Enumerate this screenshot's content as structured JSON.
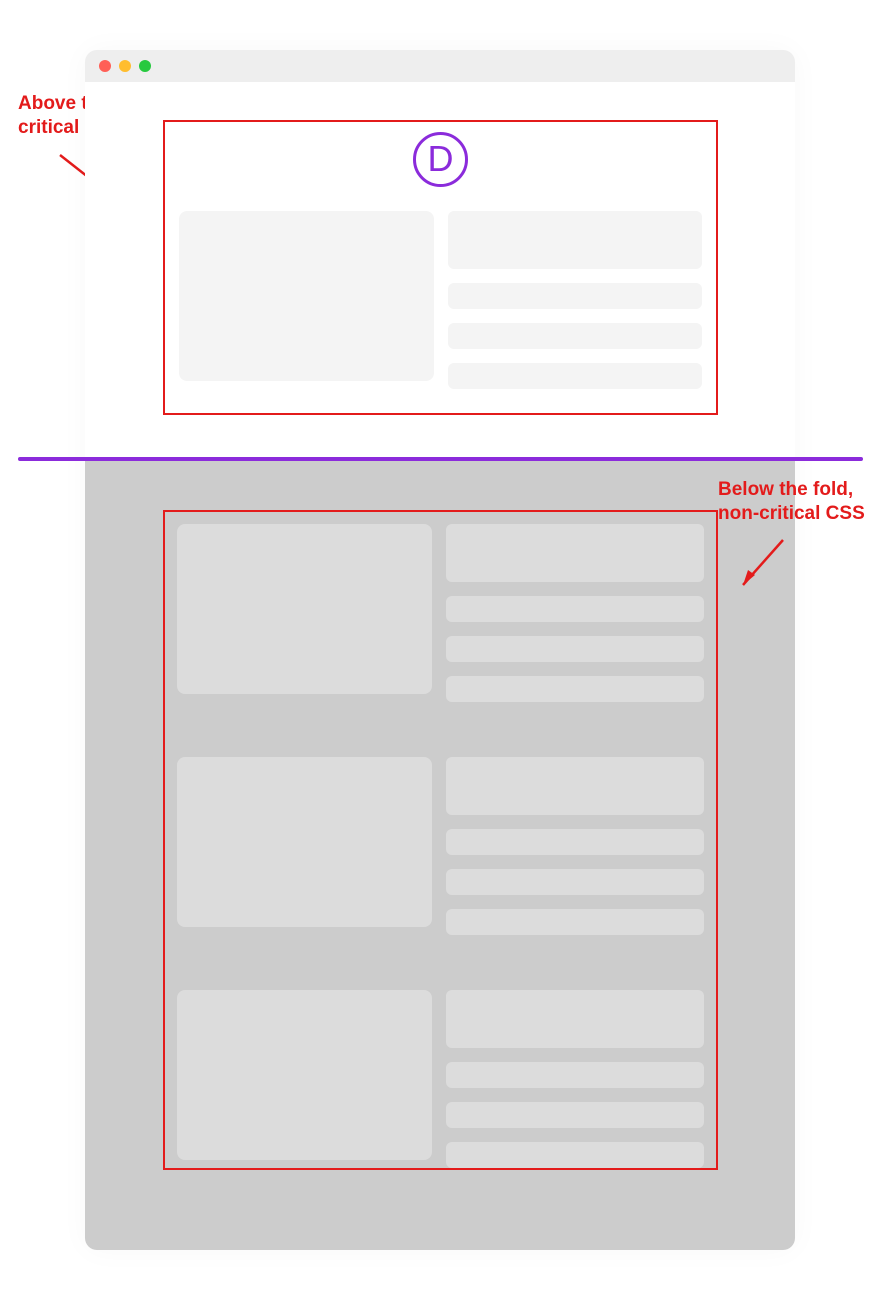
{
  "annotations": {
    "above_line1": "Above the fold,",
    "above_line2": "critical CSS",
    "below_line1": "Below the fold,",
    "below_line2": "non-critical CSS"
  },
  "logo": {
    "letter": "D"
  },
  "colors": {
    "annotation": "#e31b1b",
    "fold_line": "#8b2bdb",
    "logo": "#8b2bdb",
    "above_skeleton": "#f4f4f4",
    "below_bg": "#cccccc",
    "below_skeleton": "#dcdcdc"
  }
}
